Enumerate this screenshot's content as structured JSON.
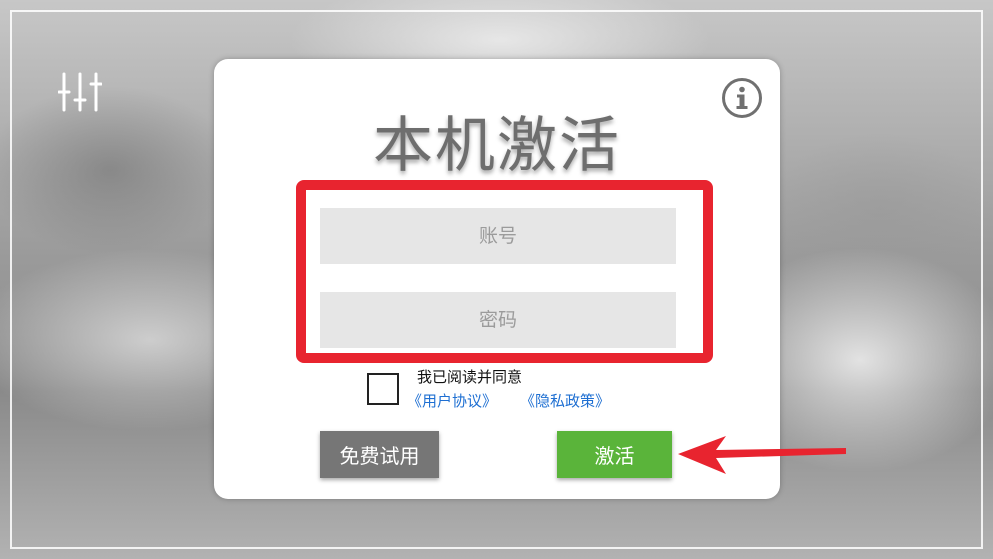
{
  "dialog": {
    "title": "本机激活",
    "account_placeholder": "账号",
    "password_placeholder": "密码",
    "agree_text": "我已阅读并同意",
    "user_agreement_link": "《用户协议》",
    "privacy_policy_link": "《隐私政策》",
    "trial_button": "免费试用",
    "activate_button": "激活"
  },
  "icons": {
    "settings": "sliders-icon",
    "info": "info-icon",
    "annotation_arrow": "left-arrow-icon"
  },
  "colors": {
    "highlight": "#e8242f",
    "activate_button": "#5ab43a",
    "trial_button": "#767676",
    "link": "#1e6fd2",
    "title": "#6e6e6e"
  },
  "checkbox": {
    "checked": false
  }
}
